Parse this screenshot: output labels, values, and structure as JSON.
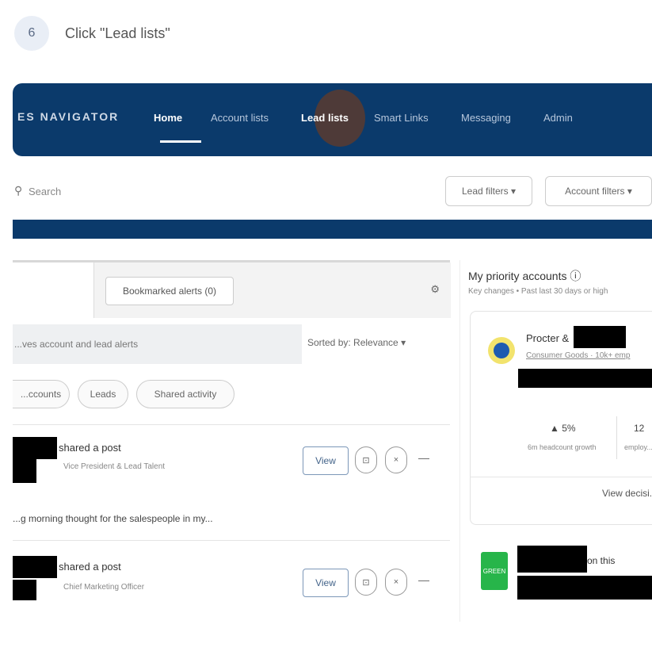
{
  "instruction": {
    "step_number": "6",
    "text": "Click \"Lead lists\""
  },
  "navbar": {
    "brand": "ES NAVIGATOR",
    "items": [
      {
        "label": "Home",
        "active": true
      },
      {
        "label": "Account lists",
        "active": false
      },
      {
        "label": "Lead lists",
        "active": false,
        "highlighted": true
      },
      {
        "label": "Smart Links",
        "active": false
      },
      {
        "label": "Messaging",
        "active": false
      },
      {
        "label": "Admin",
        "active": false
      }
    ]
  },
  "search": {
    "placeholder": "Search"
  },
  "filters": {
    "lead_filters": "Lead filters ▾",
    "account_filters": "Account filters ▾"
  },
  "feed": {
    "tab_bookmarked": "Bookmarked alerts (0)",
    "tab_icon": "⚙",
    "search_placeholder": "...ves account and lead alerts",
    "sort_label": "Sorted by: Relevance ▾",
    "chips": [
      "...ccounts",
      "Leads",
      "Shared activity"
    ],
    "items": [
      {
        "title": "shared a post",
        "sub": "Vice President & Lead Talent",
        "view": "View",
        "bookmark_icon": "⊡",
        "close_icon": "×",
        "more_icon": "—",
        "body": "...g morning thought for the salespeople in my..."
      },
      {
        "title": "shared a post",
        "sub": "Chief Marketing Officer",
        "view": "View",
        "bookmark_icon": "⊡",
        "close_icon": "×",
        "more_icon": "—"
      }
    ]
  },
  "sidebar": {
    "title": "My priority accounts ⓘ",
    "subtitle": "Key changes • Past last 30 days or high",
    "account1": {
      "name": "Procter &",
      "detail": "Consumer Goods · 10k+ emp",
      "stat1_value": "▲ 5%",
      "stat1_label": "6m headcount growth",
      "stat2_value": "12",
      "stat2_label": "employ...",
      "view_label": "View decisi..."
    },
    "account2": {
      "logo_text": "GREEN",
      "name": "on this"
    }
  },
  "colors": {
    "navbar": "#0b3a6b",
    "highlight": "#5a3b2f"
  }
}
